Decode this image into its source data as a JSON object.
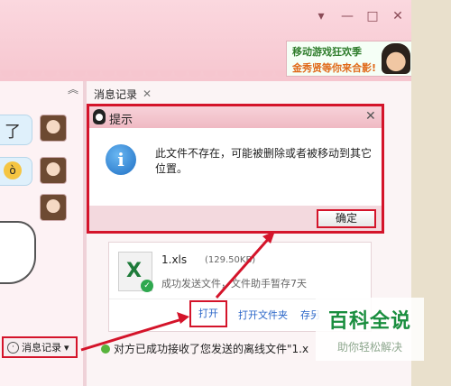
{
  "window": {
    "controls": [
      "▾",
      "—",
      "□",
      "✕"
    ]
  },
  "ad": {
    "line1": "移动游戏狂欢季",
    "line2": "金秀贤等你来合影!"
  },
  "left_pane": {
    "chat_fragment": "了",
    "history_button": {
      "label": "消息记录",
      "arrow": "▾"
    }
  },
  "history_tab": {
    "label": "消息记录",
    "close": "✕"
  },
  "dialog": {
    "title": "提示",
    "close": "✕",
    "icon": "i",
    "message": "此文件不存在，可能被删除或者被移动到其它位置。",
    "ok_label": "确定"
  },
  "file_card": {
    "name": "1.xls",
    "size": "(129.50KB)",
    "status": "成功发送文件，文件助手暂存7天",
    "actions": {
      "open": "打开",
      "open_folder": "打开文件夹",
      "save": "存另"
    }
  },
  "bottom_message": "对方已成功接收了您发送的离线文件\"1.x",
  "watermark": {
    "title": "百科全说",
    "subtitle": "助你轻松解决"
  },
  "colors": {
    "highlight": "#d4142a",
    "link": "#2a66c8",
    "window_pink": "#f6c6cf"
  }
}
